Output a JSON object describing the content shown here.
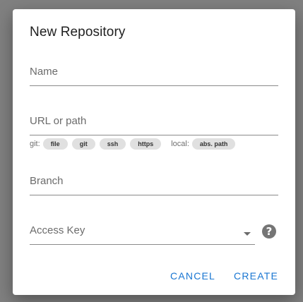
{
  "dialog": {
    "title": "New Repository"
  },
  "fields": {
    "name": {
      "label": "Name",
      "value": ""
    },
    "url": {
      "label": "URL or path",
      "value": ""
    },
    "branch": {
      "label": "Branch",
      "value": ""
    },
    "access_key": {
      "label": "Access Key",
      "value": ""
    }
  },
  "hints": {
    "git_label": "git:",
    "git_chips": [
      "file",
      "git",
      "ssh",
      "https"
    ],
    "local_label": "local:",
    "local_chips": [
      "abs. path"
    ]
  },
  "icons": {
    "help": "help-circle-icon",
    "dropdown": "chevron-down-icon"
  },
  "actions": {
    "cancel": "CANCEL",
    "create": "CREATE"
  },
  "colors": {
    "accent": "#1976d2",
    "overlay": "#808080"
  }
}
